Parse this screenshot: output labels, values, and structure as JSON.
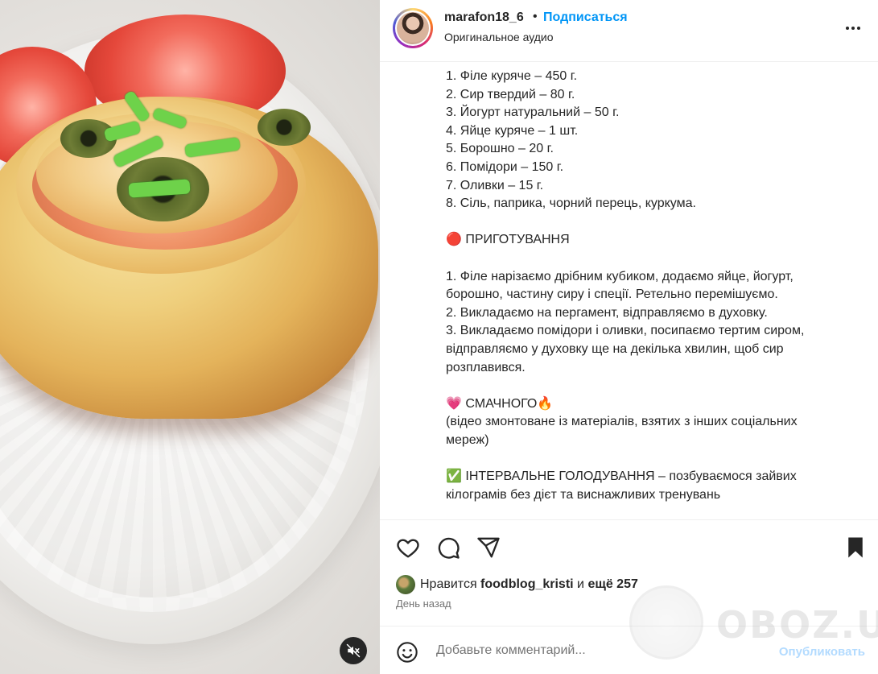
{
  "post": {
    "username": "marafon18_6",
    "separator": "•",
    "follow_label": "Подписаться",
    "audio_label": "Оригинальное аудио"
  },
  "caption": {
    "lines": [
      "1. Філе куряче – 450 г.",
      "2. Сир твердий – 80 г.",
      "3. Йогурт натуральний – 50 г.",
      "4. Яйце куряче – 1 шт.",
      "5. Борошно – 20 г.",
      "6. Помідори – 150 г.",
      "7. Оливки – 15 г.",
      "8. Сіль, паприка, чорний перець, куркума.",
      "",
      "🔴 ПРИГОТУВАННЯ",
      "",
      "1. Філе нарізаємо дрібним кубиком, додаємо яйце, йогурт,",
      "борошно, частину сиру і спеції. Ретельно перемішуємо.",
      "2. Викладаємо на пергамент, відправляємо в духовку.",
      "3. Викладаємо помідори і оливки, посипаємо тертим сиром,",
      "відправляємо у духовку ще на декілька хвилин, щоб сир",
      "розплавився.",
      "",
      "💗 СМАЧНОГО🔥",
      "(відео змонтоване із матеріалів, взятих з інших соціальних",
      "мереж)",
      "",
      "✅ ІНТЕРВАЛЬНЕ ГОЛОДУВАННЯ – позбуваємося зайвих",
      "кілограмів без дієт та виснажливих тренувань"
    ]
  },
  "likes": {
    "prefix": "Нравится ",
    "user": "foodblog_kristi",
    "middle": " и ",
    "count": "ещё 257"
  },
  "time_label": "День назад",
  "comment": {
    "placeholder": "Добавьте комментарий...",
    "publish_label": "Опубликовать"
  },
  "watermark": {
    "text": "OBOZ.UA"
  },
  "icons": {
    "like": "heart-icon",
    "comment": "comment-icon",
    "share": "share-icon",
    "save": "bookmark-icon",
    "emoji": "emoji-icon",
    "mute": "muted-speaker-icon",
    "more": "more-icon"
  },
  "colors": {
    "link_blue": "#0095f6",
    "publish_disabled": "#b3dbff",
    "text": "#262626",
    "muted": "#737373"
  }
}
